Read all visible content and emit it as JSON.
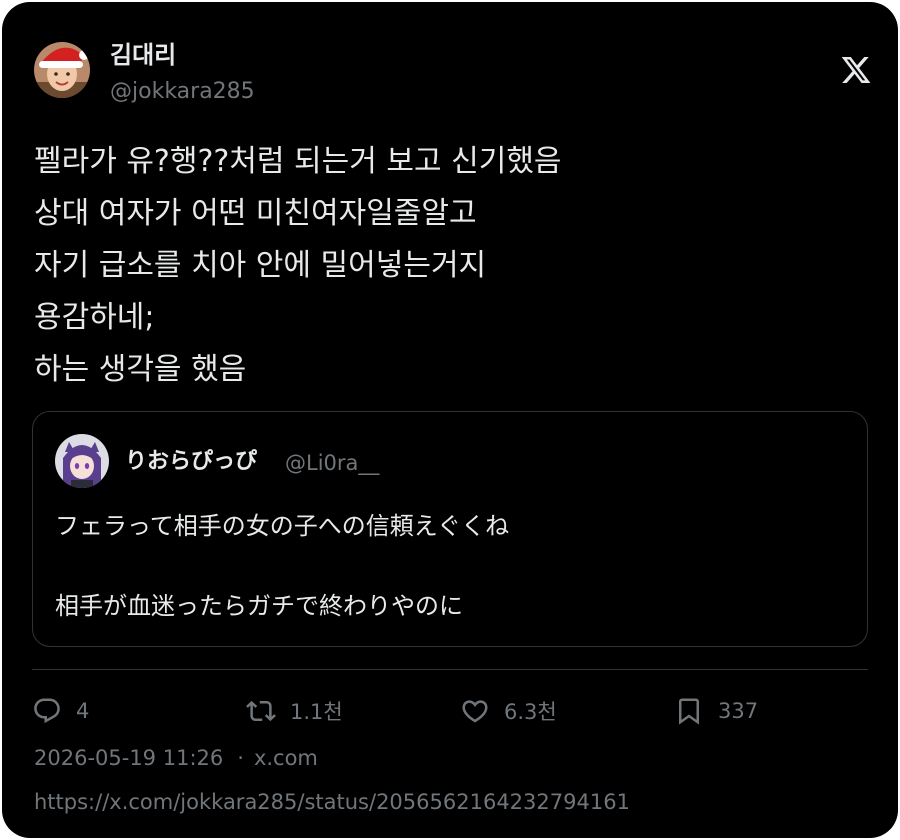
{
  "author": {
    "display_name": "김대리",
    "handle": "@jokkara285",
    "avatar_icon": "santa-hat-avatar-icon"
  },
  "tweet": {
    "lines": [
      "펠라가 유?행??처럼 되는거 보고 신기했음",
      "상대 여자가 어떤 미친여자일줄알고",
      "자기 급소를 치아 안에 밀어넣는거지",
      "용감하네;",
      "하는 생각을 했음"
    ]
  },
  "quoted": {
    "display_name": "りおらぴっぴ",
    "handle": "@Li0ra__",
    "avatar_icon": "anime-girl-avatar-icon",
    "lines": [
      "フェラって相手の女の子への信頼えぐくね",
      "",
      "相手が血迷ったらガチで終わりやのに"
    ]
  },
  "actions": {
    "replies": "4",
    "reposts": "1.1천",
    "likes": "6.3천",
    "bookmarks": "337"
  },
  "meta": {
    "timestamp": "2026-05-19 11:26",
    "separator": "·",
    "source": "x.com"
  },
  "url": "https://x.com/jokkara285/status/2056562164232794161",
  "colors": {
    "background": "#000000",
    "text": "#e7e9ea",
    "secondary": "#71767b",
    "border": "#2f3336"
  }
}
